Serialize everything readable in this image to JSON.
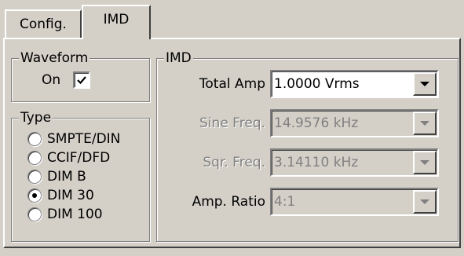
{
  "tabs": [
    {
      "label": "Config."
    },
    {
      "label": "IMD"
    }
  ],
  "waveform": {
    "legend": "Waveform",
    "on_label": "On",
    "checked": true
  },
  "type": {
    "legend": "Type",
    "options": [
      {
        "label": "SMPTE/DIN",
        "selected": false
      },
      {
        "label": "CCIF/DFD",
        "selected": false
      },
      {
        "label": "DIM B",
        "selected": false
      },
      {
        "label": "DIM 30",
        "selected": true
      },
      {
        "label": "DIM 100",
        "selected": false
      }
    ]
  },
  "imd": {
    "legend": "IMD",
    "fields": [
      {
        "label": "Total Amp",
        "value": "1.0000 Vrms",
        "enabled": true
      },
      {
        "label": "Sine Freq.",
        "value": "14.9576 kHz",
        "enabled": false
      },
      {
        "label": "Sqr. Freq.",
        "value": "3.14110 kHz",
        "enabled": false
      },
      {
        "label": "Amp. Ratio",
        "value": "4:1",
        "enabled": false
      }
    ]
  }
}
